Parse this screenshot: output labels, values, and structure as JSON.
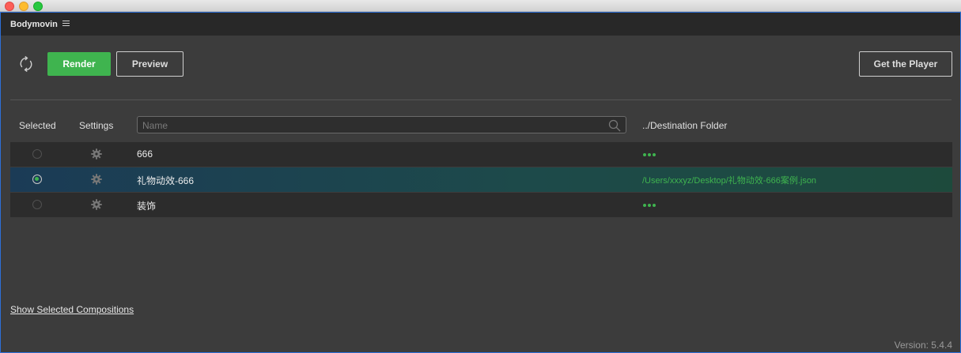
{
  "panel": {
    "title": "Bodymovin"
  },
  "toolbar": {
    "render_label": "Render",
    "preview_label": "Preview",
    "player_label": "Get the Player"
  },
  "columns": {
    "selected": "Selected",
    "settings": "Settings",
    "destination": "../Destination Folder"
  },
  "search": {
    "placeholder": "Name",
    "value": ""
  },
  "compositions": [
    {
      "name": "666",
      "selected": false,
      "destination": ""
    },
    {
      "name": "礼物动效-666",
      "selected": true,
      "destination": "/Users/xxxyz/Desktop/礼物动效-666案例.json"
    },
    {
      "name": "装饰",
      "selected": false,
      "destination": ""
    }
  ],
  "footer": {
    "show_selected": "Show Selected Compositions",
    "version": "Version: 5.4.4"
  },
  "colors": {
    "accent_green": "#3fb44f",
    "panel_border": "#2d6fd8",
    "header_bg": "#282828",
    "row_bg": "#2c2c2c"
  },
  "icons": [
    "refresh-icon",
    "menu-icon",
    "search-icon",
    "gear-icon",
    "more-dots-icon"
  ]
}
